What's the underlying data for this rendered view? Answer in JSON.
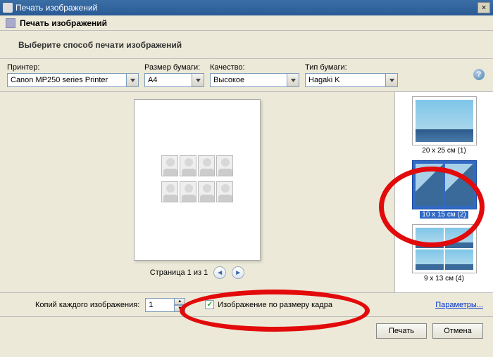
{
  "titlebar": {
    "title": "Печать изображений",
    "close": "×"
  },
  "subtitle": "Печать изображений",
  "instruction": "Выберите способ печати изображений",
  "options": {
    "printer": {
      "label": "Принтер:",
      "value": "Canon MP250 series Printer"
    },
    "paper_size": {
      "label": "Размер бумаги:",
      "value": "A4"
    },
    "quality": {
      "label": "Качество:",
      "value": "Высокое"
    },
    "paper_type": {
      "label": "Тип бумаги:",
      "value": "Hagaki K"
    }
  },
  "help_char": "?",
  "pager": {
    "text": "Страница 1 из 1",
    "prev": "◄",
    "next": "►"
  },
  "layouts": [
    {
      "label": "20 x 25 см (1)"
    },
    {
      "label": "10 x 15 см (2)"
    },
    {
      "label": "9 x 13 см (4)"
    }
  ],
  "copies": {
    "label": "Копий каждого изображения:",
    "value": "1"
  },
  "fit_checkbox": {
    "label": "Изображение по размеру кадра",
    "checked": "✓"
  },
  "params_link": "Параметры...",
  "buttons": {
    "print": "Печать",
    "cancel": "Отмена"
  }
}
